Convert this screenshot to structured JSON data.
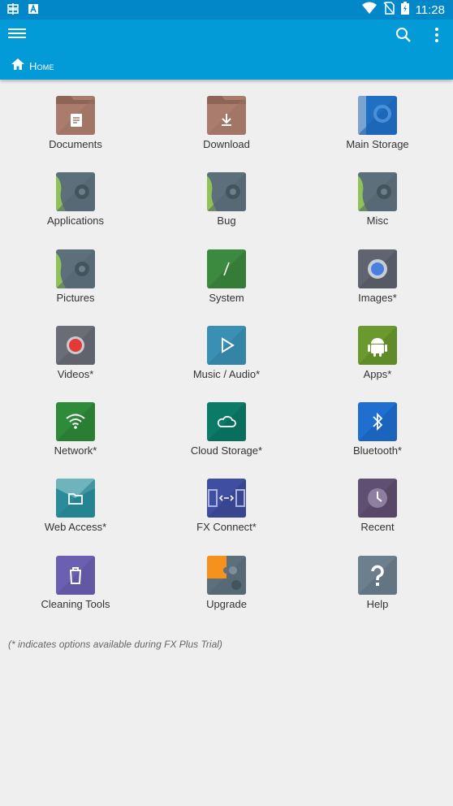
{
  "status_bar": {
    "time": "11:28"
  },
  "breadcrumb": {
    "label": "Home"
  },
  "tiles": [
    {
      "label": "Documents",
      "icon": "documents-folder-icon",
      "color": "#a97c6d"
    },
    {
      "label": "Download",
      "icon": "download-folder-icon",
      "color": "#a97c6d"
    },
    {
      "label": "Main Storage",
      "icon": "main-storage-icon",
      "color": "#1f6fc2"
    },
    {
      "label": "Applications",
      "icon": "applications-icon",
      "color": "#5c6f7b"
    },
    {
      "label": "Bug",
      "icon": "bug-icon",
      "color": "#5c6f7b"
    },
    {
      "label": "Misc",
      "icon": "misc-icon",
      "color": "#5c6f7b"
    },
    {
      "label": "Pictures",
      "icon": "pictures-icon",
      "color": "#5c6f7b"
    },
    {
      "label": "System",
      "icon": "system-icon",
      "color": "#3b8a3f"
    },
    {
      "label": "Images*",
      "icon": "images-icon",
      "color": "#5f6470"
    },
    {
      "label": "Videos*",
      "icon": "videos-icon",
      "color": "#6a6d75"
    },
    {
      "label": "Music / Audio*",
      "icon": "music-audio-icon",
      "color": "#3a90b4"
    },
    {
      "label": "Apps*",
      "icon": "apps-android-icon",
      "color": "#6a9a2e"
    },
    {
      "label": "Network*",
      "icon": "network-wifi-icon",
      "color": "#2e8b3a"
    },
    {
      "label": "Cloud Storage*",
      "icon": "cloud-storage-icon",
      "color": "#0b7a66"
    },
    {
      "label": "Bluetooth*",
      "icon": "bluetooth-icon",
      "color": "#1e6fd0"
    },
    {
      "label": "Web Access*",
      "icon": "web-access-icon",
      "color": "#2a8b99"
    },
    {
      "label": "FX Connect*",
      "icon": "fx-connect-icon",
      "color": "#3f4ea0"
    },
    {
      "label": "Recent",
      "icon": "recent-clock-icon",
      "color": "#5f4f72"
    },
    {
      "label": "Cleaning Tools",
      "icon": "trash-icon",
      "color": "#6a5fb0"
    },
    {
      "label": "Upgrade",
      "icon": "upgrade-puzzle-icon",
      "color": "#5c6f7b"
    },
    {
      "label": "Help",
      "icon": "help-icon",
      "color": "#6c7f8c"
    }
  ],
  "footnote": "(* indicates options available during FX Plus Trial)"
}
